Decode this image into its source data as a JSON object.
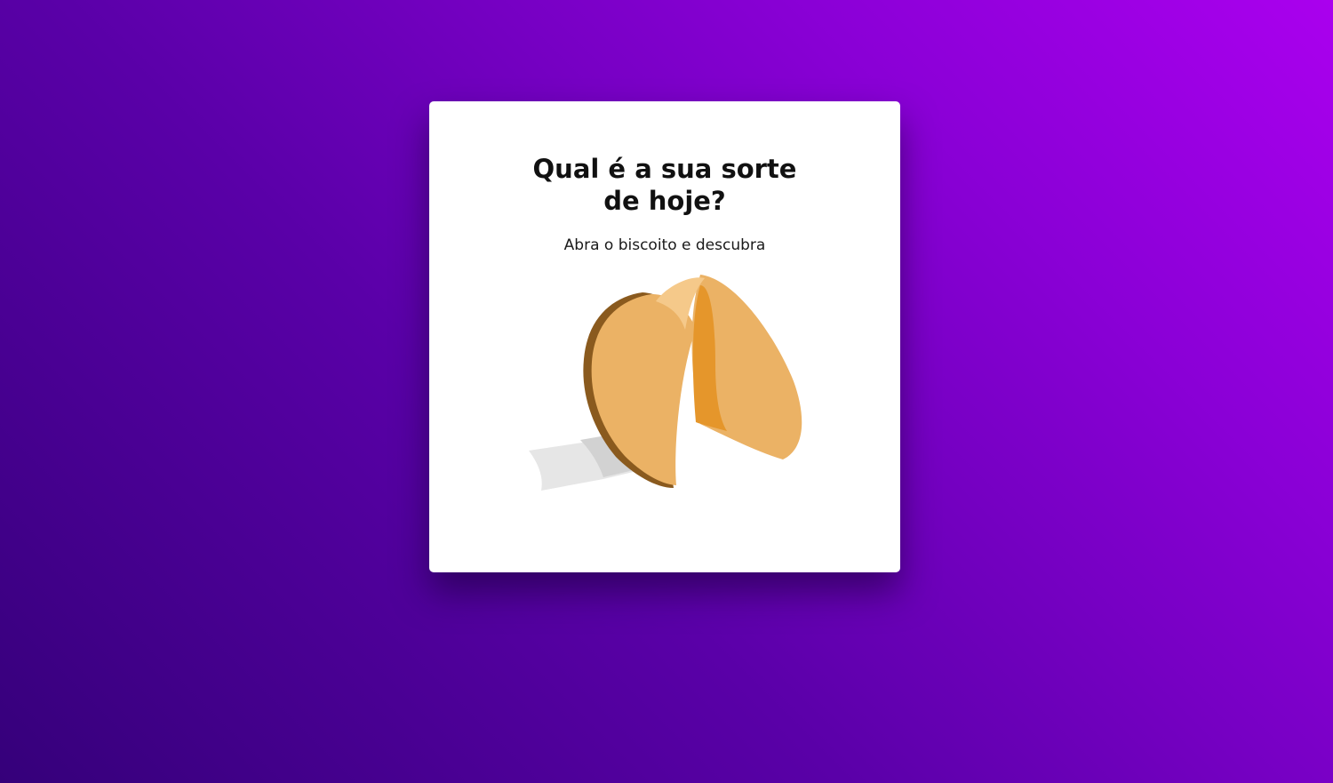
{
  "card": {
    "title": "Qual é a sua sorte de hoje?",
    "subtitle": "Abra o biscoito e descubra"
  },
  "cookie": {
    "icon": "fortune-cookie-icon",
    "colors": {
      "dough": "#ebb265",
      "dough_light": "#f5c98a",
      "dough_dark": "#e5962b",
      "crust": "#8a5a1e",
      "paper": "#e6e6e6",
      "paper_shadow": "#d2d2d2"
    }
  },
  "theme": {
    "gradient_start": "#35007a",
    "gradient_end": "#aa00ee"
  }
}
